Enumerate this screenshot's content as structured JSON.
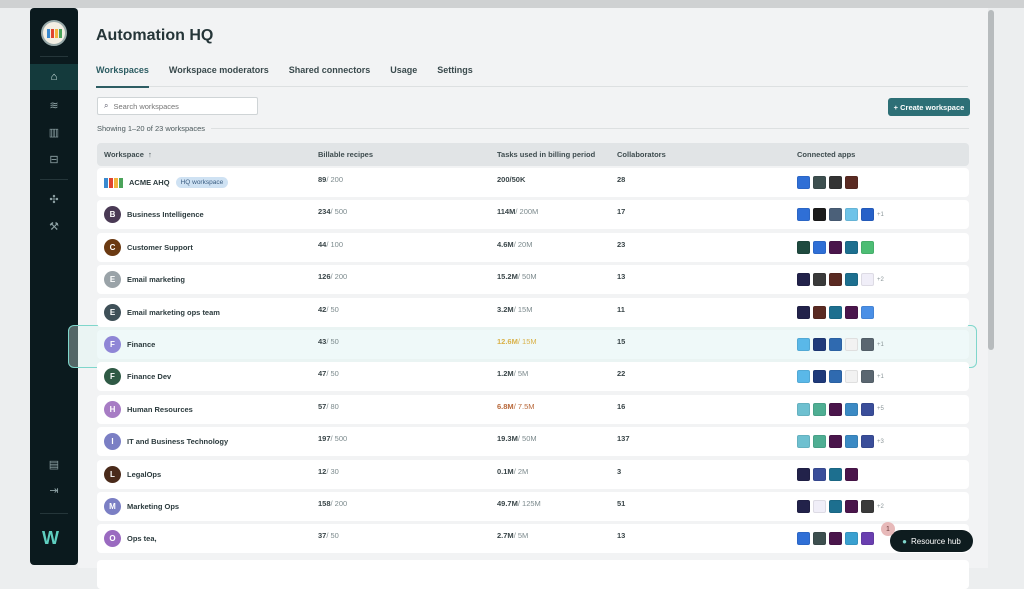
{
  "app_title": "Automation HQ",
  "sidebar": {
    "items": [
      "home",
      "layers",
      "analytics",
      "docs",
      "integrations",
      "tools",
      "reports",
      "logout"
    ]
  },
  "tabs": [
    {
      "label": "Workspaces",
      "active": true
    },
    {
      "label": "Workspace moderators"
    },
    {
      "label": "Shared connectors"
    },
    {
      "label": "Usage"
    },
    {
      "label": "Settings"
    }
  ],
  "search": {
    "placeholder": "Search workspaces",
    "value": ""
  },
  "create_button": "+ Create workspace",
  "showing": "Showing 1–20 of 23 workspaces",
  "columns": [
    "Workspace",
    "Billable recipes",
    "Tasks used in billing period",
    "Collaborators",
    "Connected apps"
  ],
  "sort_icon": "arrow-up-icon",
  "colors": {
    "accent": "#2d6f76",
    "highlight": "#7fd6cb",
    "warn": "#d9b24a",
    "danger": "#b8683a"
  },
  "app_colors": {
    "jira": "#2f6fd6",
    "sumo": "#3d4f4f",
    "github": "#333333",
    "office": "#5a2a22",
    "dark": "#1c1c1c",
    "check": "#4b6079",
    "kube": "#6ec3e8",
    "trello": "#2761c8",
    "zendesk": "#1f4a3f",
    "slack": "#4a154b",
    "salesforce": "#1d6f8f",
    "green": "#4dbd74",
    "gong": "#22224a",
    "rainbow": "#3a3a3a",
    "shield": "#f0eef8",
    "zoom": "#4a8fe6",
    "lightblue": "#5ab8e8",
    "anaplan": "#1f3a7a",
    "sap": "#2f6ab0",
    "white": "#f2f2f2",
    "gray": "#5a6670",
    "workday": "#6ec0d0",
    "greenhouse": "#4fae93",
    "okta": "#3b8ac4",
    "yellow": "#3a4e9a",
    "box": "#3aa0d0",
    "dropbox": "#6a3fb0"
  },
  "rows": [
    {
      "name": "ACME AHQ",
      "badge": "HQ workspace",
      "avatar": "",
      "avatar_color": "",
      "recipes": "89",
      "recipes_limit": " / 200",
      "tasks": "200/50K",
      "tasks_limit": "",
      "collaborators": "28",
      "apps": [
        "jira",
        "sumo",
        "github",
        "office"
      ],
      "more": ""
    },
    {
      "name": "Business Intelligence",
      "avatar": "B",
      "avatar_color": "#4a3a55",
      "recipes": "234",
      "recipes_limit": " / 500",
      "tasks": "114M",
      "tasks_limit": " / 200M",
      "collaborators": "17",
      "apps": [
        "jira",
        "dark",
        "check",
        "kube",
        "trello"
      ],
      "more": "+1"
    },
    {
      "name": "Customer Support",
      "avatar": "C",
      "avatar_color": "#6b3a12",
      "recipes": "44",
      "recipes_limit": " / 100",
      "tasks": "4.6M",
      "tasks_limit": " / 20M",
      "collaborators": "23",
      "apps": [
        "zendesk",
        "jira",
        "slack",
        "salesforce",
        "green"
      ],
      "more": ""
    },
    {
      "name": "Email marketing",
      "avatar": "E",
      "avatar_color": "#9aa3a8",
      "recipes": "126",
      "recipes_limit": " / 200",
      "tasks": "15.2M",
      "tasks_limit": " / 50M",
      "collaborators": "13",
      "apps": [
        "gong",
        "rainbow",
        "office",
        "salesforce",
        "shield"
      ],
      "more": "+2"
    },
    {
      "name": "Email marketing ops team",
      "avatar": "E",
      "avatar_color": "#3f5058",
      "recipes": "42",
      "recipes_limit": " / 50",
      "tasks": "3.2M",
      "tasks_limit": " / 15M",
      "collaborators": "11",
      "apps": [
        "gong",
        "office",
        "salesforce",
        "slack",
        "zoom"
      ],
      "more": ""
    },
    {
      "name": "Finance",
      "avatar": "F",
      "avatar_color": "#8f86d6",
      "recipes": "43",
      "recipes_limit": " / 50",
      "tasks": "12.6M",
      "tasks_limit": " / 15M",
      "tasks_status": "warn",
      "collaborators": "15",
      "apps": [
        "lightblue",
        "anaplan",
        "sap",
        "white",
        "gray"
      ],
      "more": "+1",
      "highlighted": true
    },
    {
      "name": "Finance Dev",
      "avatar": "F",
      "avatar_color": "#2f5a45",
      "recipes": "47",
      "recipes_limit": " / 50",
      "tasks": "1.2M",
      "tasks_limit": " / 5M",
      "collaborators": "22",
      "apps": [
        "lightblue",
        "anaplan",
        "sap",
        "white",
        "gray"
      ],
      "more": "+1"
    },
    {
      "name": "Human Resources",
      "avatar": "H",
      "avatar_color": "#a77cc4",
      "recipes": "57",
      "recipes_limit": " / 80",
      "tasks": "6.8M",
      "tasks_limit": " / 7.5M",
      "tasks_status": "danger",
      "collaborators": "16",
      "apps": [
        "workday",
        "greenhouse",
        "slack",
        "okta",
        "yellow"
      ],
      "more": "+5"
    },
    {
      "name": "IT and Business Technology",
      "avatar": "I",
      "avatar_color": "#7b7fc4",
      "recipes": "197",
      "recipes_limit": " / 500",
      "tasks": "19.3M",
      "tasks_limit": " / 50M",
      "collaborators": "137",
      "apps": [
        "workday",
        "greenhouse",
        "slack",
        "okta",
        "yellow"
      ],
      "more": "+3"
    },
    {
      "name": "LegalOps",
      "avatar": "L",
      "avatar_color": "#4a2a1a",
      "recipes": "12",
      "recipes_limit": " / 30",
      "tasks": "0.1M",
      "tasks_limit": " / 2M",
      "collaborators": "3",
      "apps": [
        "gong",
        "yellow",
        "salesforce",
        "slack"
      ],
      "more": ""
    },
    {
      "name": "Marketing Ops",
      "avatar": "M",
      "avatar_color": "#7b7fc4",
      "recipes": "158",
      "recipes_limit": " / 200",
      "tasks": "49.7M",
      "tasks_limit": " / 125M",
      "collaborators": "51",
      "apps": [
        "gong",
        "shield",
        "salesforce",
        "slack",
        "rainbow"
      ],
      "more": "+2"
    },
    {
      "name": "Ops tea,",
      "avatar": "O",
      "avatar_color": "#9a6ac0",
      "recipes": "37",
      "recipes_limit": " / 50",
      "tasks": "2.7M",
      "tasks_limit": " / 5M",
      "collaborators": "13",
      "apps": [
        "jira",
        "sumo",
        "slack",
        "box",
        "dropbox"
      ],
      "more": ""
    }
  ],
  "resource_hub": {
    "label": "Resource hub",
    "count": "1"
  }
}
